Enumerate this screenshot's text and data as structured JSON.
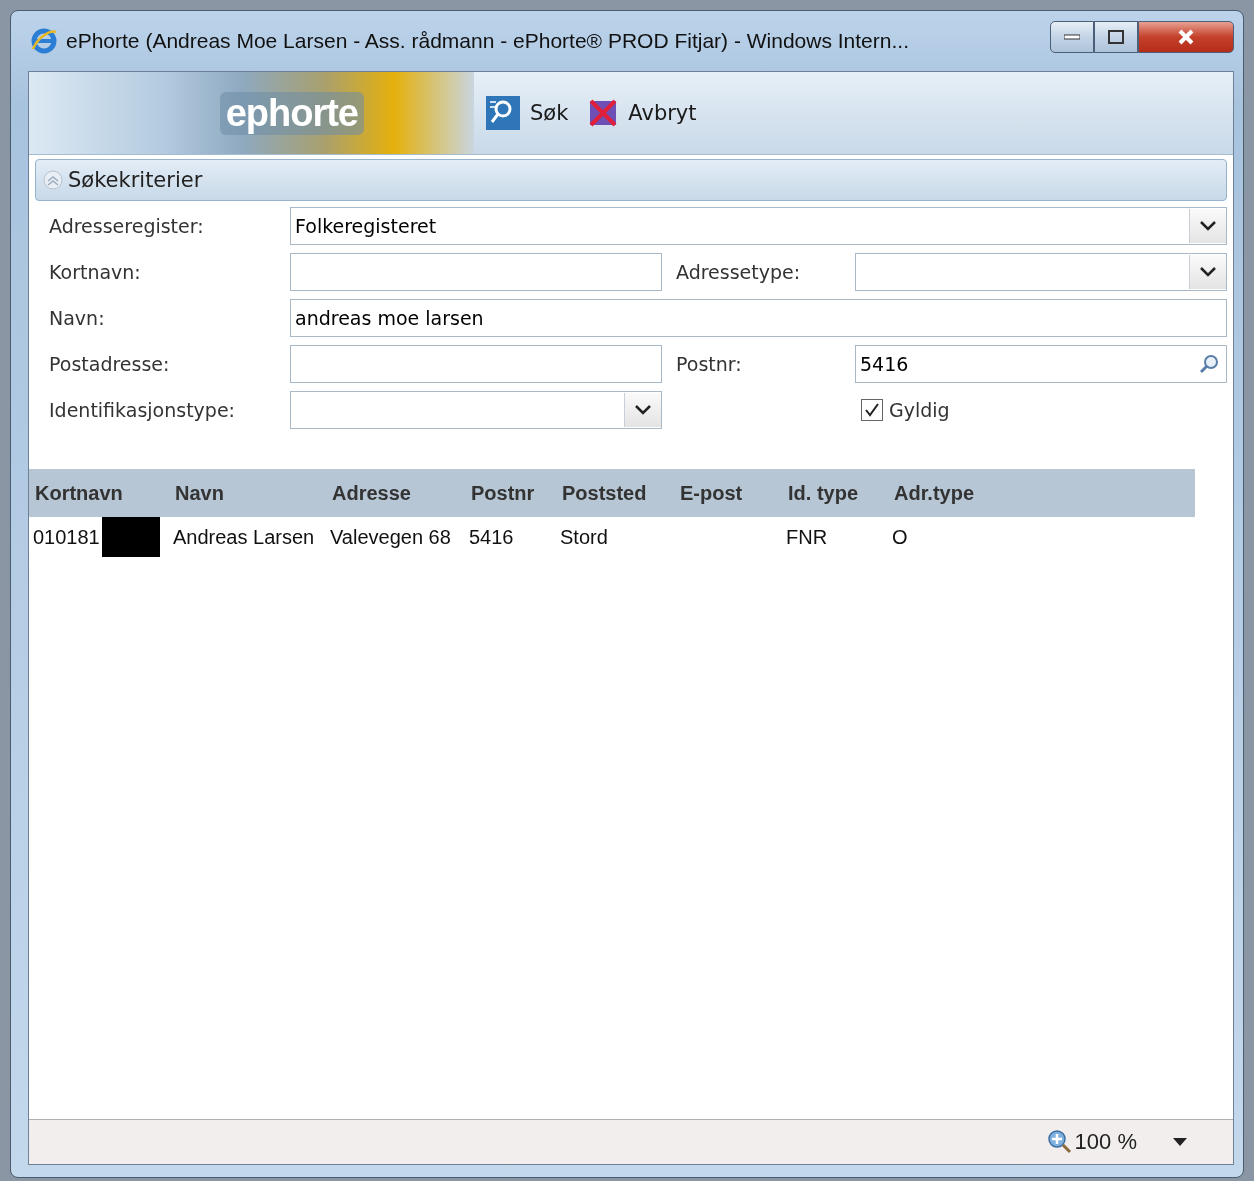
{
  "window": {
    "title": "ePhorte (Andreas Moe Larsen - Ass. rådmann - ePhorte® PROD Fitjar) - Windows Intern..."
  },
  "header": {
    "logo": "ephorte",
    "toolbar": [
      {
        "kind": "search",
        "label": "Søk"
      },
      {
        "kind": "cancel",
        "label": "Avbryt"
      }
    ]
  },
  "section": {
    "title": "Søkekriterier",
    "expanded": true
  },
  "form": {
    "rows": [
      {
        "fields": [
          {
            "kind": "select",
            "label": "Adresseregister:",
            "value": "Folkeregisteret",
            "wide": true
          }
        ]
      },
      {
        "fields": [
          {
            "kind": "text",
            "label": "Kortnavn:",
            "wide": false
          },
          {
            "kind": "select",
            "label": "Adressetype:",
            "wide": false
          }
        ]
      },
      {
        "fields": [
          {
            "kind": "text",
            "label": "Navn:",
            "value": "andreas moe larsen",
            "wide": true
          }
        ]
      },
      {
        "fields": [
          {
            "kind": "text",
            "label": "Postadresse:",
            "wide": false
          },
          {
            "kind": "lookup",
            "label": "Postnr:",
            "value": "5416",
            "wide": false
          }
        ]
      },
      {
        "fields": [
          {
            "kind": "select",
            "label": "Identifikasjonstype:",
            "wide": false
          },
          {
            "kind": "checkbox",
            "label": "Gyldig",
            "checked": true
          }
        ]
      }
    ]
  },
  "table": {
    "columns": [
      "Kortnavn",
      "Navn",
      "Adresse",
      "Postnr",
      "Poststed",
      "E-post",
      "Id. type",
      "Adr.type"
    ],
    "rows": [
      {
        "cells": [
          {
            "text": "010181",
            "redacted": true
          },
          {
            "text": "Andreas Larsen"
          },
          {
            "text": "Valevegen 68"
          },
          {
            "text": "5416"
          },
          {
            "text": "Stord"
          },
          {},
          {
            "text": "FNR"
          },
          {
            "text": "O"
          }
        ]
      }
    ]
  },
  "status_bar": {
    "zoom": "100 %"
  }
}
